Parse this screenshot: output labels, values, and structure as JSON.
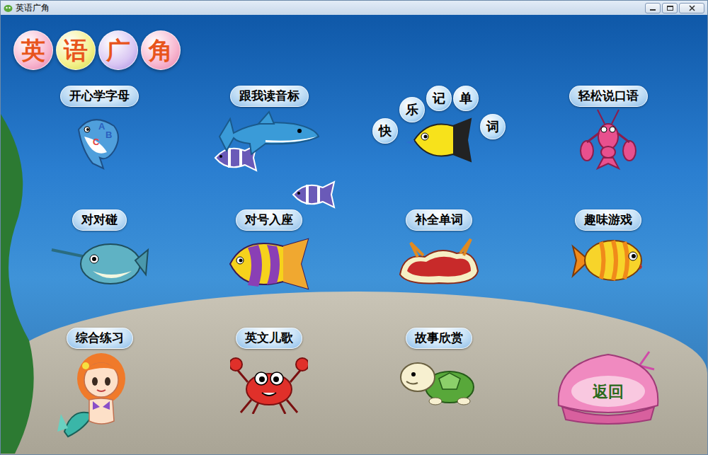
{
  "window": {
    "title": "英语广角"
  },
  "logo": {
    "chars": [
      "英",
      "语",
      "广",
      "角"
    ]
  },
  "menu": [
    {
      "label": "开心学字母",
      "kind": "letterfish",
      "letters": [
        "A",
        "B",
        "C"
      ]
    },
    {
      "label": "跟我读音标",
      "kind": "shark"
    },
    {
      "label_chars": [
        "快",
        "乐",
        "记",
        "单",
        "词"
      ],
      "kind": "yellowfish"
    },
    {
      "label": "轻松说口语",
      "kind": "lobster"
    },
    {
      "label": "对对碰",
      "kind": "pufferfish"
    },
    {
      "label": "对号入座",
      "kind": "stripedfish"
    },
    {
      "label": "补全单词",
      "kind": "seaslug"
    },
    {
      "label": "趣味游戏",
      "kind": "orangefish"
    },
    {
      "label": "综合练习",
      "kind": "mermaid"
    },
    {
      "label": "英文儿歌",
      "kind": "crab"
    },
    {
      "label": "故事欣赏",
      "kind": "turtle"
    }
  ],
  "back_button": {
    "label": "返回"
  }
}
